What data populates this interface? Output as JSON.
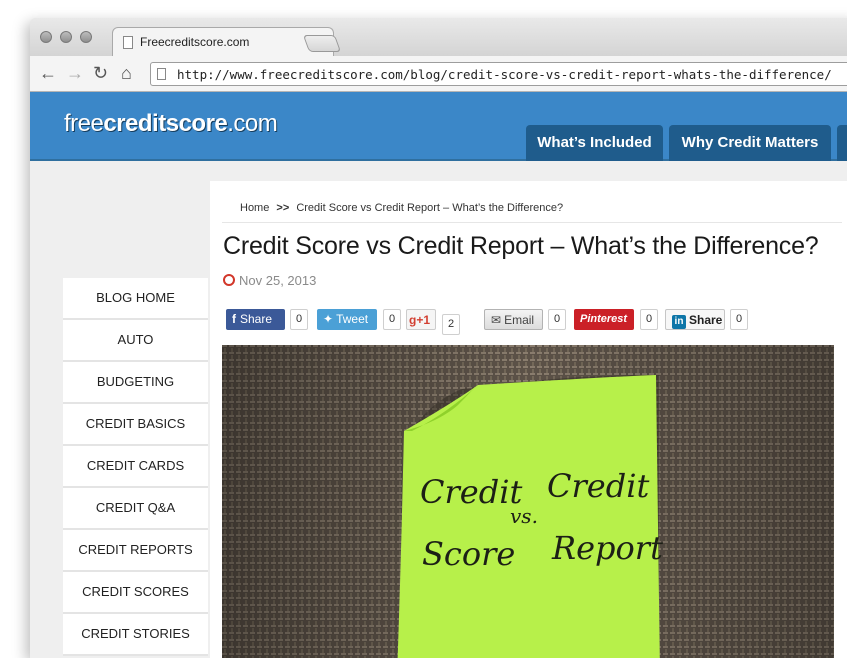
{
  "browser": {
    "tab_title": "Freecreditscore.com",
    "tab_close": "×",
    "url": "http://www.freecreditscore.com/blog/credit-score-vs-credit-report-whats-the-difference/",
    "back_icon": "arrow-left-icon",
    "forward_icon": "arrow-right-icon",
    "reload_icon": "reload-icon",
    "home_icon": "home-icon"
  },
  "site": {
    "logo_light": "free",
    "logo_bold": "creditscore",
    "logo_tail": ".com",
    "nav": [
      "What’s Included",
      "Why Credit Matters"
    ],
    "colors": {
      "header": "#3b87c8",
      "nav_tab": "#1f5c8c"
    }
  },
  "sidebar": {
    "items": [
      "BLOG HOME",
      "AUTO",
      "BUDGETING",
      "CREDIT BASICS",
      "CREDIT CARDS",
      "CREDIT Q&A",
      "CREDIT REPORTS",
      "CREDIT SCORES",
      "CREDIT STORIES"
    ]
  },
  "article": {
    "breadcrumb_home": "Home",
    "breadcrumb_sep": ">>",
    "breadcrumb_current": "Credit Score vs Credit Report – What’s the Difference?",
    "title": "Credit Score vs Credit Report – What’s the Difference?",
    "date": "Nov 25, 2013",
    "share": {
      "facebook": {
        "label": "Share",
        "count": "0"
      },
      "twitter": {
        "label": "Tweet",
        "count": "0"
      },
      "gplus": {
        "label": "+1",
        "count": "2"
      },
      "email": {
        "label": "Email",
        "count": "0"
      },
      "pinterest": {
        "label": "Pinterest",
        "count": "0"
      },
      "linkedin": {
        "label": "Share",
        "count": "0"
      }
    },
    "note": {
      "line1": "Credit",
      "line2": "Score",
      "vs": "vs.",
      "line3": "Credit",
      "line4": "Report"
    }
  }
}
